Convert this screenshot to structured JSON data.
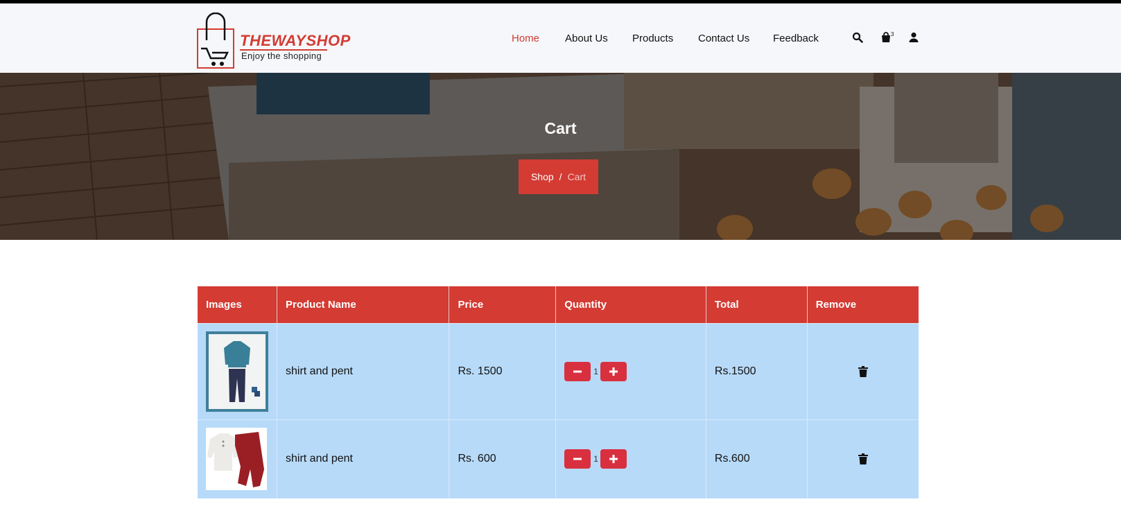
{
  "brand": {
    "name": "THEWAYSHOP",
    "tagline": "Enjoy the shopping",
    "accent": "#d33b33"
  },
  "nav": {
    "items": [
      {
        "label": "Home",
        "active": true
      },
      {
        "label": "About Us",
        "active": false
      },
      {
        "label": "Products",
        "active": false
      },
      {
        "label": "Contact Us",
        "active": false
      },
      {
        "label": "Feedback",
        "active": false
      }
    ]
  },
  "toolbar": {
    "icons": [
      "search-icon",
      "shopping-bag-icon",
      "user-icon"
    ],
    "cart_count": "3"
  },
  "hero": {
    "title": "Cart",
    "breadcrumb": {
      "parent": "Shop",
      "separator": "/",
      "current": "Cart"
    }
  },
  "cart": {
    "columns": [
      "Images",
      "Product Name",
      "Price",
      "Quantity",
      "Total",
      "Remove"
    ],
    "rows": [
      {
        "name": "shirt and pent",
        "price": "Rs. 1500",
        "quantity": "1",
        "total": "Rs.1500",
        "image": "blue-shirt-navy-pants"
      },
      {
        "name": "shirt and pent",
        "price": "Rs. 600",
        "quantity": "1",
        "total": "Rs.600",
        "image": "white-shirt-red-pants"
      }
    ],
    "row_color": "#b7daf9",
    "button_color": "#d9303f"
  }
}
